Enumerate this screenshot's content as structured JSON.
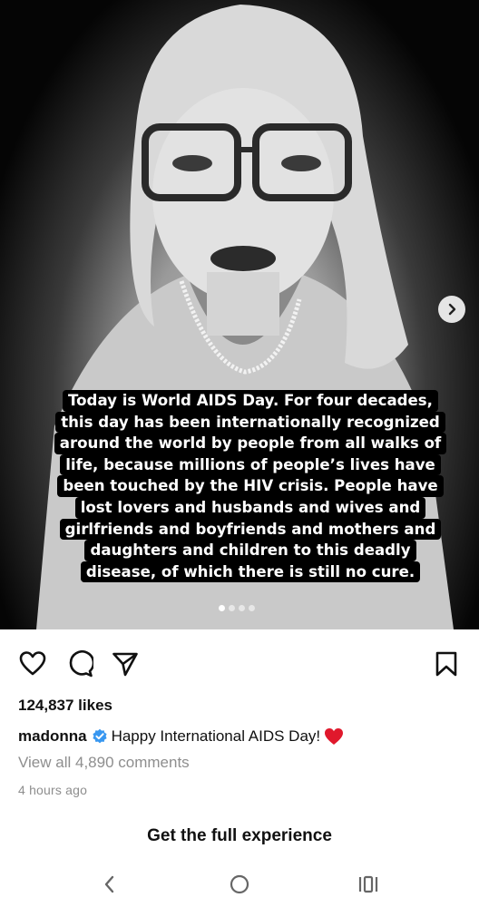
{
  "post": {
    "overlay_lines": [
      "Today is World AIDS Day. For four decades,",
      "this day has been internationally recognized",
      "around the world by people from all walks of",
      "life, because millions of people’s lives have",
      "been touched by the HIV crisis. People have",
      "lost lovers and husbands and wives and",
      "girlfriends and boyfriends and mothers and",
      "daughters and children to this deadly",
      "disease, of which there is still no cure."
    ],
    "carousel": {
      "count": 4,
      "active_index": 0
    },
    "next_icon": "chevron-right-icon"
  },
  "actions": {
    "like_icon": "heart-outline-icon",
    "comment_icon": "comment-bubble-icon",
    "share_icon": "paper-plane-icon",
    "save_icon": "bookmark-icon"
  },
  "likes_text": "124,837 likes",
  "caption": {
    "username": "madonna",
    "verified_icon": "verified-badge-icon",
    "text": "Happy International AIDS Day!",
    "emoji_icon": "red-heart-emoji-icon"
  },
  "comments_link": "View all 4,890 comments",
  "timestamp": "4 hours ago",
  "cta": "Get the full experience",
  "navbar": {
    "back_icon": "back-chevron-icon",
    "home_icon": "home-circle-icon",
    "recents_icon": "recent-apps-icon"
  },
  "colors": {
    "verified_blue": "#3897f0",
    "heart_red": "#e0182c",
    "muted_text": "#8e8e8e"
  }
}
